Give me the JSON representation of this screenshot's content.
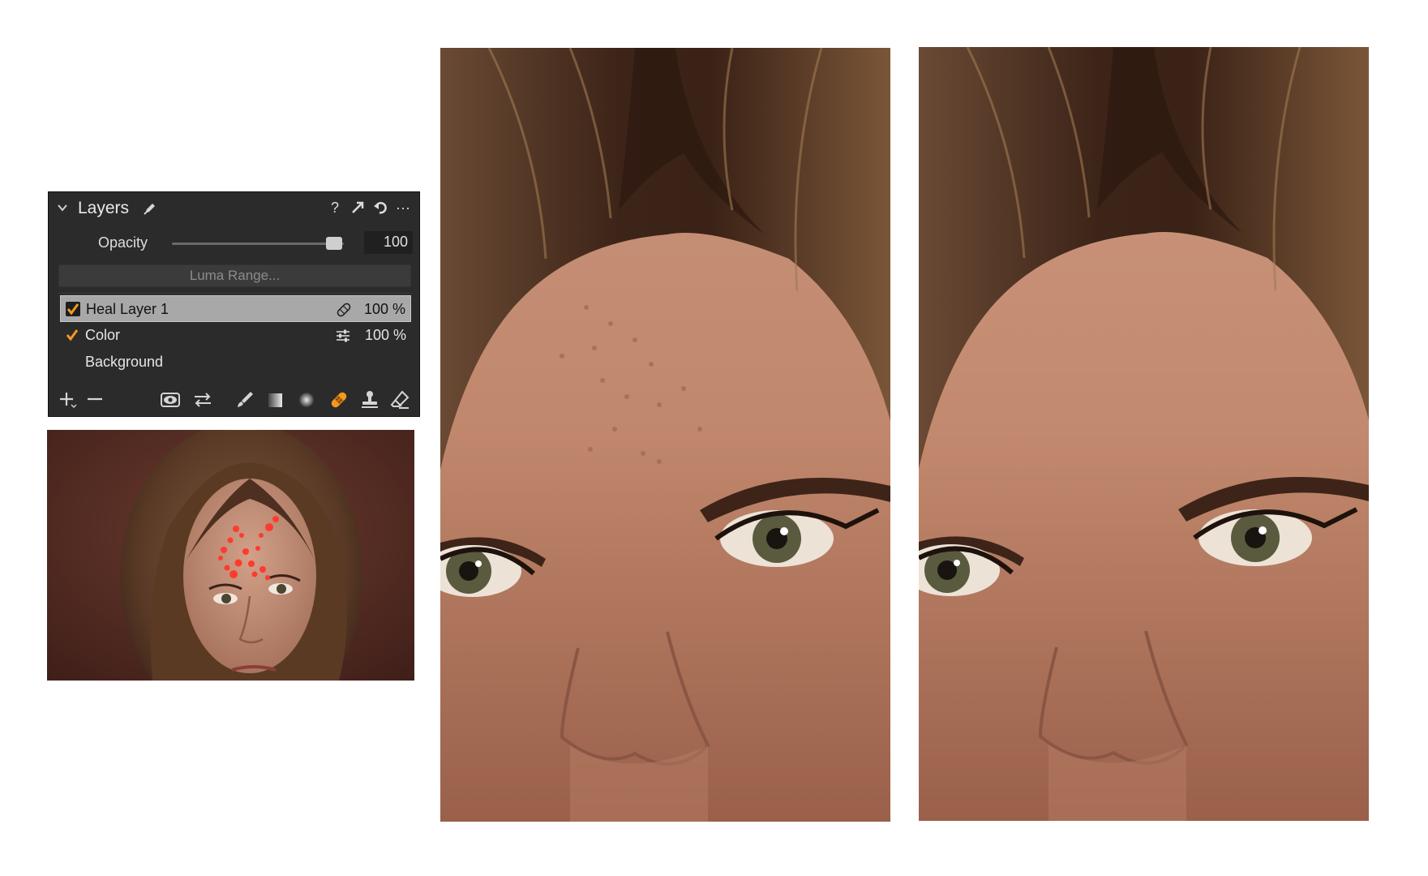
{
  "layers_panel": {
    "title": "Layers",
    "header_icons": [
      "pen-icon",
      "help-icon",
      "expand-icon",
      "reset-icon",
      "more-icon"
    ],
    "help_glyph": "?",
    "more_glyph": "···",
    "opacity": {
      "label": "Opacity",
      "value": "100",
      "fraction": 1.0
    },
    "luma_range_label": "Luma Range...",
    "layers": [
      {
        "name": "Heal Layer 1",
        "checked": true,
        "selected": true,
        "icon": "bandage-icon",
        "opacity": "100 %"
      },
      {
        "name": "Color",
        "checked": true,
        "selected": false,
        "icon": "sliders-icon",
        "opacity": "100 %"
      },
      {
        "name": "Background",
        "checked": false,
        "selected": false,
        "icon": "",
        "opacity": ""
      }
    ],
    "toolbar": [
      "add-icon",
      "remove-icon",
      "eye-icon",
      "swap-icon",
      "brush-icon",
      "linear-gradient-icon",
      "radial-gradient-icon",
      "heal-icon",
      "clone-stamp-icon",
      "eraser-icon"
    ],
    "active_tool": "heal-icon"
  },
  "colors": {
    "panel_bg": "#2b2b2b",
    "accent": "#f39a1e",
    "selection": "#a8a8a8",
    "heal_marker": "#ff3a2e"
  },
  "images": {
    "thumbnail": "full portrait with red heal markers on forehead",
    "crop_before": "close-up forehead and eyes before healing",
    "crop_after": "close-up forehead and eyes after healing"
  }
}
